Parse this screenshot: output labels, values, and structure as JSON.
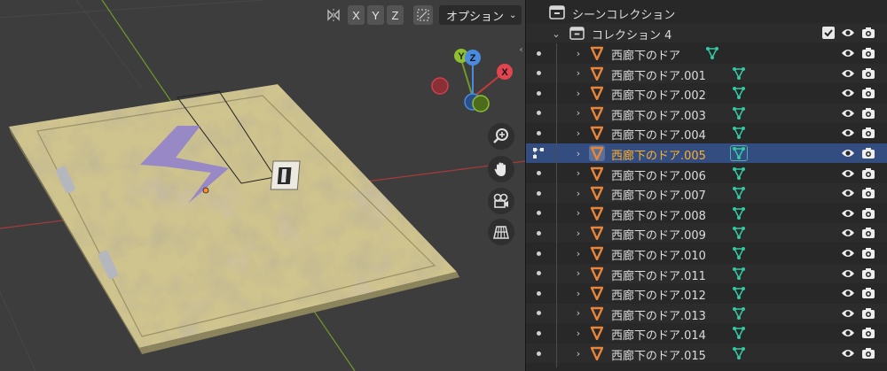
{
  "viewport": {
    "header": {
      "mirror_axes": [
        "X",
        "Y",
        "Z"
      ],
      "options_label": "オプション"
    },
    "gizmo_axes": {
      "x": "X",
      "y": "Y",
      "z": "Z"
    },
    "colors": {
      "background": "#3d3d3d",
      "grid_line": "#4a4a4a",
      "x_axis": "#a83a3a",
      "y_axis": "#6f9a2c",
      "door_fill": "#cfc38e",
      "lightning": "#8e7fd0",
      "origin": "#ff8c2a"
    },
    "nav_buttons": [
      "zoom-icon",
      "hand-icon",
      "camera-icon",
      "grid-icon"
    ]
  },
  "outliner": {
    "scene_label": "シーンコレクション",
    "collection_label": "コレクション 4",
    "items": [
      {
        "name": "西廊下のドア"
      },
      {
        "name": "西廊下のドア.001"
      },
      {
        "name": "西廊下のドア.002"
      },
      {
        "name": "西廊下のドア.003"
      },
      {
        "name": "西廊下のドア.004"
      },
      {
        "name": "西廊下のドア.005",
        "selected": true
      },
      {
        "name": "西廊下のドア.006"
      },
      {
        "name": "西廊下のドア.007"
      },
      {
        "name": "西廊下のドア.008"
      },
      {
        "name": "西廊下のドア.009"
      },
      {
        "name": "西廊下のドア.010"
      },
      {
        "name": "西廊下のドア.011"
      },
      {
        "name": "西廊下のドア.012"
      },
      {
        "name": "西廊下のドア.013"
      },
      {
        "name": "西廊下のドア.014"
      },
      {
        "name": "西廊下のドア.015"
      }
    ],
    "colors": {
      "selected_row": "#334d80",
      "selected_text": "#ffaf29",
      "object_icon": "#e8853a",
      "mesh_icon": "#34c9a3"
    }
  }
}
